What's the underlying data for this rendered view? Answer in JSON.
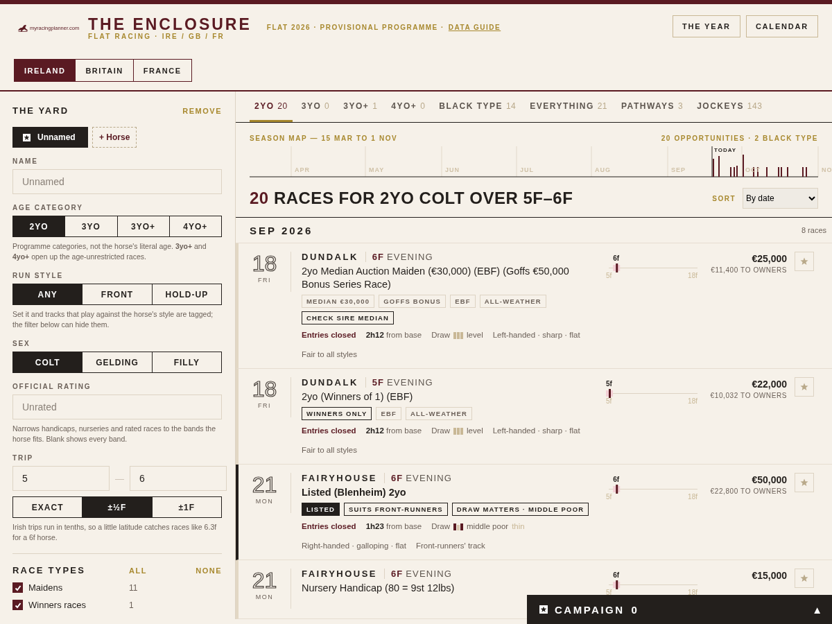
{
  "header": {
    "logo_text": "myracingplanner.com",
    "title": "THE ENCLOSURE",
    "subtitle": "FLAT RACING · IRE / GB / FR",
    "tagline": "FLAT 2026 · PROVISIONAL PROGRAMME ·",
    "link": "DATA GUIDE",
    "buttons": [
      "THE YEAR",
      "CALENDAR"
    ]
  },
  "countries": [
    {
      "label": "IRELAND",
      "selected": true
    },
    {
      "label": "BRITAIN",
      "selected": false
    },
    {
      "label": "FRANCE",
      "selected": false
    }
  ],
  "sidebar": {
    "title": "THE YARD",
    "remove": "REMOVE",
    "horses": [
      {
        "label": "Unnamed",
        "kind": "horse",
        "selected": true
      },
      {
        "label": "+ Horse",
        "kind": "add",
        "selected": false
      }
    ],
    "sections": [
      {
        "kind": "field",
        "label": "NAME",
        "placeholder": "Unnamed"
      },
      {
        "kind": "segments",
        "label": "AGE CATEGORY",
        "options": [
          {
            "label": "2YO",
            "selected": true
          },
          {
            "label": "3YO",
            "selected": false
          },
          {
            "label": "3YO+",
            "selected": false
          },
          {
            "label": "4YO+",
            "selected": false
          }
        ],
        "help": "Programme categories, not the horse's literal age. **3yo+** and **4yo+** open up the age-unrestricted races."
      },
      {
        "kind": "segments",
        "label": "RUN STYLE",
        "options": [
          {
            "label": "ANY",
            "selected": true
          },
          {
            "label": "FRONT",
            "selected": false
          },
          {
            "label": "HOLD-UP",
            "selected": false
          }
        ],
        "help": "Set it and tracks that play against the horse's style are tagged; the filter below can hide them."
      },
      {
        "kind": "segments",
        "label": "SEX",
        "options": [
          {
            "label": "COLT",
            "selected": true
          },
          {
            "label": "GELDING",
            "selected": false
          },
          {
            "label": "FILLY",
            "selected": false
          }
        ]
      },
      {
        "kind": "field",
        "label": "OFFICIAL RATING",
        "placeholder": "Unrated",
        "help": "Narrows handicaps, nurseries and rated races to the bands the horse fits. Blank shows every band."
      },
      {
        "kind": "range",
        "label": "TRIP",
        "from": "5",
        "separator": "—",
        "to": "6"
      },
      {
        "kind": "segments",
        "options": [
          {
            "label": "EXACT",
            "selected": false
          },
          {
            "label": "±½F",
            "selected": true
          },
          {
            "label": "±1F",
            "selected": false
          }
        ],
        "help": "Irish trips run in tenths, so a little latitude catches races like 6.3f for a 6f horse."
      }
    ],
    "race_types": {
      "title": "RACE TYPES",
      "all": "ALL",
      "none": "NONE",
      "items": [
        {
          "label": "Maidens",
          "count": "11",
          "checked": true
        },
        {
          "label": "Winners races",
          "count": "1",
          "checked": true
        }
      ]
    }
  },
  "tabs": [
    {
      "label": "2YO",
      "count": "20",
      "selected": true
    },
    {
      "label": "3YO",
      "count": "0",
      "selected": false
    },
    {
      "label": "3YO+",
      "count": "1",
      "selected": false
    },
    {
      "label": "4YO+",
      "count": "0",
      "selected": false
    },
    {
      "label": "BLACK TYPE",
      "count": "14",
      "selected": false
    },
    {
      "label": "EVERYTHING",
      "count": "21",
      "selected": false
    },
    {
      "label": "PATHWAYS",
      "count": "3",
      "selected": false
    },
    {
      "label": "JOCKEYS",
      "count": "143",
      "selected": false
    }
  ],
  "season_map": {
    "title": "SEASON MAP — 15 MAR TO 1 NOV",
    "summary": "20 OPPORTUNITIES · 2 BLACK TYPE",
    "months": [
      "APR",
      "MAY",
      "JUN",
      "JUL",
      "AUG",
      "SEP",
      "OCT",
      "NO"
    ],
    "today": "TODAY"
  },
  "heading": {
    "count": "20",
    "text": "RACES FOR 2YO COLT OVER 5F–6F",
    "sort_label": "SORT",
    "sort_value": "By date"
  },
  "month": {
    "title": "SEP 2026",
    "count": "8 races"
  },
  "races": [
    {
      "day": "18",
      "weekday": "FRI",
      "venue": "DUNDALK",
      "trip": "6F",
      "time": "EVENING",
      "title": "2yo Median Auction Maiden (€30,000) (EBF) (Goffs €50,000 Bonus Series Race)",
      "black_type": false,
      "tag_rows": [
        [
          {
            "label": "MEDIAN €30,000",
            "kind": "plain"
          },
          {
            "label": "GOFFS BONUS",
            "kind": "plain"
          },
          {
            "label": "EBF",
            "kind": "plain"
          },
          {
            "label": "ALL-WEATHER",
            "kind": "plain"
          }
        ],
        [
          {
            "label": "CHECK SIRE MEDIAN",
            "kind": "outline"
          }
        ]
      ],
      "status": "Entries closed",
      "travel": "2h12",
      "travel_note": "from base",
      "draw": {
        "label": "Draw",
        "kind": "level",
        "text": "level"
      },
      "track": "Left-handed · sharp · flat",
      "notes": [
        "Fair to all styles"
      ],
      "meter": {
        "mark": "6f",
        "min": "5f",
        "max": "18f",
        "level": 0.08
      },
      "prize": "€25,000",
      "owners": "€11,400 TO OWNERS"
    },
    {
      "day": "18",
      "weekday": "FRI",
      "venue": "DUNDALK",
      "trip": "5F",
      "time": "EVENING",
      "title": "2yo (Winners of 1) (EBF)",
      "black_type": false,
      "tag_rows": [
        [
          {
            "label": "WINNERS ONLY",
            "kind": "outline"
          },
          {
            "label": "EBF",
            "kind": "plain"
          },
          {
            "label": "ALL-WEATHER",
            "kind": "plain"
          }
        ]
      ],
      "status": "Entries closed",
      "travel": "2h12",
      "travel_note": "from base",
      "draw": {
        "label": "Draw",
        "kind": "level",
        "text": "level"
      },
      "track": "Left-handed · sharp · flat",
      "notes": [
        "Fair to all styles"
      ],
      "meter": {
        "mark": "5f",
        "min": "5f",
        "max": "18f",
        "level": 0.0
      },
      "prize": "€22,000",
      "owners": "€10,032 TO OWNERS"
    },
    {
      "day": "21",
      "weekday": "MON",
      "venue": "FAIRYHOUSE",
      "trip": "6F",
      "time": "EVENING",
      "title": "Listed (Blenheim) 2yo",
      "black_type": true,
      "tag_rows": [
        [
          {
            "label": "LISTED",
            "kind": "solid"
          },
          {
            "label": "SUITS FRONT-RUNNERS",
            "kind": "outline"
          },
          {
            "label": "DRAW MATTERS · MIDDLE POOR",
            "kind": "outline"
          }
        ]
      ],
      "status": "Entries closed",
      "travel": "1h23",
      "travel_note": "from base",
      "draw": {
        "label": "Draw",
        "kind": "middle_poor",
        "text": "middle poor",
        "note": "thin"
      },
      "notes": [
        "Right-handed · galloping · flat",
        "Front-runners' track"
      ],
      "meter": {
        "mark": "6f",
        "min": "5f",
        "max": "18f",
        "level": 0.08
      },
      "prize": "€50,000",
      "owners": "€22,800 TO OWNERS"
    },
    {
      "day": "21",
      "weekday": "MON",
      "venue": "FAIRYHOUSE",
      "trip": "6F",
      "time": "EVENING",
      "title": "Nursery Handicap (80 = 9st 12lbs)",
      "black_type": false,
      "meter": {
        "mark": "6f",
        "min": "5f",
        "max": "18f",
        "level": 0.08
      },
      "prize": "€15,000"
    }
  ],
  "campaign": {
    "label": "CAMPAIGN",
    "count": "0",
    "toggle": "▲"
  }
}
